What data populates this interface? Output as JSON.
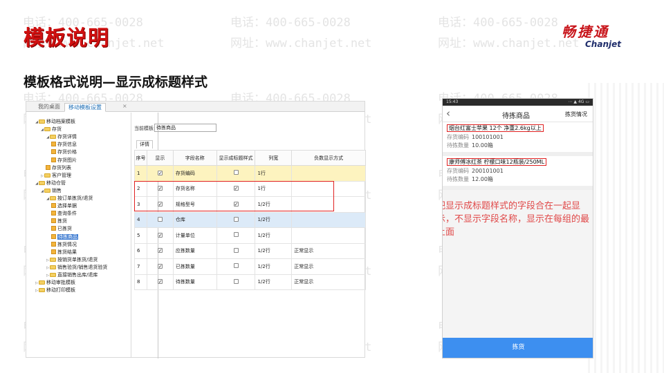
{
  "watermark": {
    "phone": "电话：400-665-0028",
    "site": "网址：www.chanjet.net"
  },
  "slide": {
    "title": "模板说明",
    "subtitle": "模板格式说明—显示成标题样式",
    "colors": {
      "title_red": "#d01010",
      "annotation_red": "#e04848",
      "accent_blue": "#3d8ff0"
    }
  },
  "logo": {
    "cn": "畅捷通",
    "en": "Chanjet"
  },
  "app": {
    "tabs": [
      "我的桌面",
      "移动模板设置"
    ],
    "close_icon": "×",
    "tree": [
      {
        "label": "移动档案模板",
        "type": "folder",
        "expanded": true
      },
      {
        "label": "存货",
        "type": "folder",
        "expanded": true
      },
      {
        "label": "存货详情",
        "type": "folder",
        "expanded": true
      },
      {
        "label": "存货信息",
        "type": "leaf"
      },
      {
        "label": "存货价格",
        "type": "leaf"
      },
      {
        "label": "存货图片",
        "type": "leaf"
      },
      {
        "label": "存货列表",
        "type": "leaf"
      },
      {
        "label": "客户管理",
        "type": "folder",
        "expanded": false
      },
      {
        "label": "移动仓管",
        "type": "folder",
        "expanded": true
      },
      {
        "label": "销售",
        "type": "folder",
        "expanded": true
      },
      {
        "label": "按订单拣货/退货",
        "type": "folder",
        "expanded": true
      },
      {
        "label": "选择单据",
        "type": "leaf"
      },
      {
        "label": "查询条件",
        "type": "leaf"
      },
      {
        "label": "拣货",
        "type": "leaf"
      },
      {
        "label": "已拣货",
        "type": "leaf"
      },
      {
        "label": "待拣商品",
        "type": "leaf",
        "selected": true
      },
      {
        "label": "拣货情况",
        "type": "leaf"
      },
      {
        "label": "拣货结果",
        "type": "leaf"
      },
      {
        "label": "按销货单拣货/退货",
        "type": "folder",
        "expanded": false
      },
      {
        "label": "销售验货/销售退货验货",
        "type": "folder",
        "expanded": false
      },
      {
        "label": "直接销售出库/退库",
        "type": "folder",
        "expanded": false
      },
      {
        "label": "移动审批模板",
        "type": "folder",
        "expanded": false
      },
      {
        "label": "移动打印模板",
        "type": "folder",
        "expanded": false
      }
    ],
    "current_template_label": "当前模板:",
    "current_template_value": "待拣商品",
    "detail_tab": "详情",
    "columns": [
      "序号",
      "显示",
      "字段名称",
      "显示成标题样式",
      "列宽",
      "负数显示方式"
    ],
    "rows": [
      {
        "no": "1",
        "show": true,
        "field": "存货编码",
        "title_style": false,
        "width": "1行",
        "neg": "",
        "highlight": "yellow"
      },
      {
        "no": "2",
        "show": true,
        "field": "存货名称",
        "title_style": true,
        "width": "1行",
        "neg": "",
        "highlight": ""
      },
      {
        "no": "3",
        "show": true,
        "field": "规格型号",
        "title_style": true,
        "width": "1/2行",
        "neg": "",
        "highlight": ""
      },
      {
        "no": "4",
        "show": false,
        "field": "仓库",
        "title_style": false,
        "width": "1/2行",
        "neg": "",
        "highlight": "blue"
      },
      {
        "no": "5",
        "show": true,
        "field": "计量单位",
        "title_style": false,
        "width": "1/2行",
        "neg": "",
        "highlight": ""
      },
      {
        "no": "6",
        "show": true,
        "field": "应拣数量",
        "title_style": false,
        "width": "1/2行",
        "neg": "正常显示",
        "highlight": ""
      },
      {
        "no": "7",
        "show": true,
        "field": "已拣数量",
        "title_style": false,
        "width": "1/2行",
        "neg": "正常显示",
        "highlight": ""
      },
      {
        "no": "8",
        "show": true,
        "field": "待拣数量",
        "title_style": false,
        "width": "1/2行",
        "neg": "正常显示",
        "highlight": ""
      }
    ]
  },
  "phone": {
    "status_time": "15:43",
    "status_right": "⋯ ▲ 4G ▭",
    "back_icon": "‹",
    "title": "待拣商品",
    "right_action": "拣货情况",
    "products": [
      {
        "name": "烟台红富士苹果 12个 净重2.6kg以上",
        "code_label": "存货编码",
        "code": "100101001",
        "qty_label": "待拣数量",
        "qty": "10.00箱"
      },
      {
        "name": "康师傅冰红茶 柠檬口味12瓶装/250ML",
        "code_label": "存货编码",
        "code": "200101001",
        "qty_label": "待拣数量",
        "qty": "12.00箱"
      }
    ],
    "annotation": "把显示成标题样式的字段合在一起显示，不显示字段名称，显示在每组的最上面",
    "bottom_button": "拣货"
  }
}
